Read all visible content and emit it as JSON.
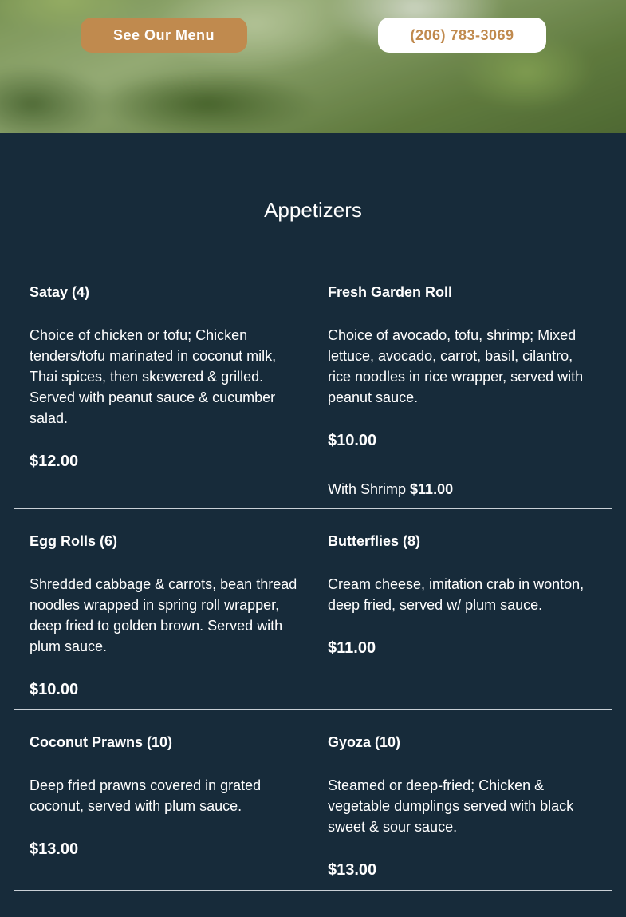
{
  "hero": {
    "menu_button_label": "See Our Menu",
    "phone_button_label": "(206) 783-3069"
  },
  "section": {
    "title": "Appetizers"
  },
  "items": [
    {
      "name": "Satay (4)",
      "description": "Choice of chicken or tofu; Chicken tenders/tofu marinated in coconut milk, Thai spices, then skewered & grilled. Served with peanut sauce & cucumber salad.",
      "price": "$12.00"
    },
    {
      "name": "Fresh Garden Roll",
      "description": "Choice of avocado, tofu, shrimp; Mixed lettuce, avocado, carrot, basil, cilantro, rice noodles in rice wrapper, served with peanut sauce.",
      "price": "$10.00",
      "option_label": "With Shrimp",
      "option_price": "$11.00"
    },
    {
      "name": "Egg Rolls (6)",
      "description": "Shredded cabbage & carrots, bean thread noodles wrapped in spring roll wrapper, deep fried to golden brown. Served with plum sauce.",
      "price": "$10.00"
    },
    {
      "name": "Butterflies (8)",
      "description": "Cream cheese, imitation crab in wonton, deep fried, served w/ plum sauce.",
      "price": "$11.00"
    },
    {
      "name": "Coconut Prawns (10)",
      "description": "Deep fried prawns covered in grated coconut, served with plum sauce.",
      "price": "$13.00"
    },
    {
      "name": "Gyoza (10)",
      "description": "Steamed or deep-fried; Chicken & vegetable dumplings served with black sweet & sour sauce.",
      "price": "$13.00"
    }
  ],
  "colors": {
    "background": "#172b3a",
    "accent": "#c08a4e",
    "text": "#ffffff",
    "divider": "#c9d0d6"
  }
}
